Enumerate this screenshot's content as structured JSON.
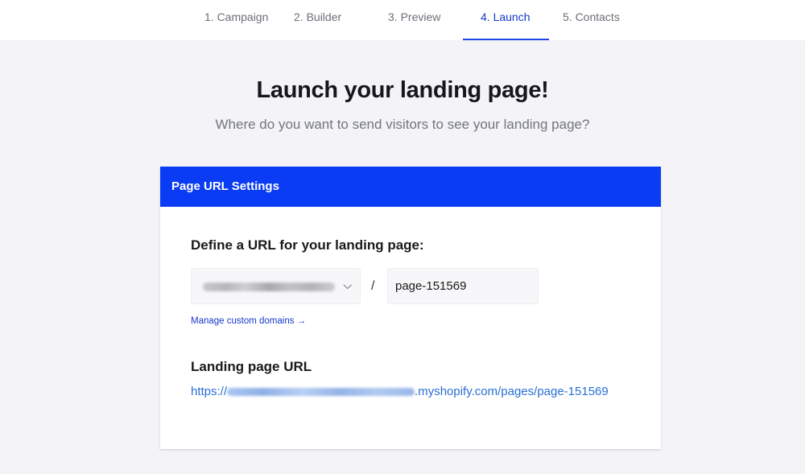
{
  "tabs": [
    {
      "label": "1. Campaign"
    },
    {
      "label": "2. Builder"
    },
    {
      "label": "3. Preview"
    },
    {
      "label": "4. Launch",
      "active": true
    },
    {
      "label": "5. Contacts"
    }
  ],
  "heading": "Launch your landing page!",
  "subheading": "Where do you want to send visitors to see your landing page?",
  "card": {
    "header": "Page URL Settings",
    "define_label": "Define a URL for your landing page:",
    "domain_select": {
      "icon": "chevron-down-icon",
      "chevron": "⌵"
    },
    "separator": "/",
    "path_value": "page-151569",
    "manage_link": "Manage custom domains →",
    "url_label": "Landing page URL",
    "url_prefix": "https://",
    "url_suffix": ".myshopify.com/pages/page-151569"
  },
  "colors": {
    "accent": "#0a3cf5",
    "active_tab": "#1739c9",
    "link": "#2a6fd6"
  }
}
